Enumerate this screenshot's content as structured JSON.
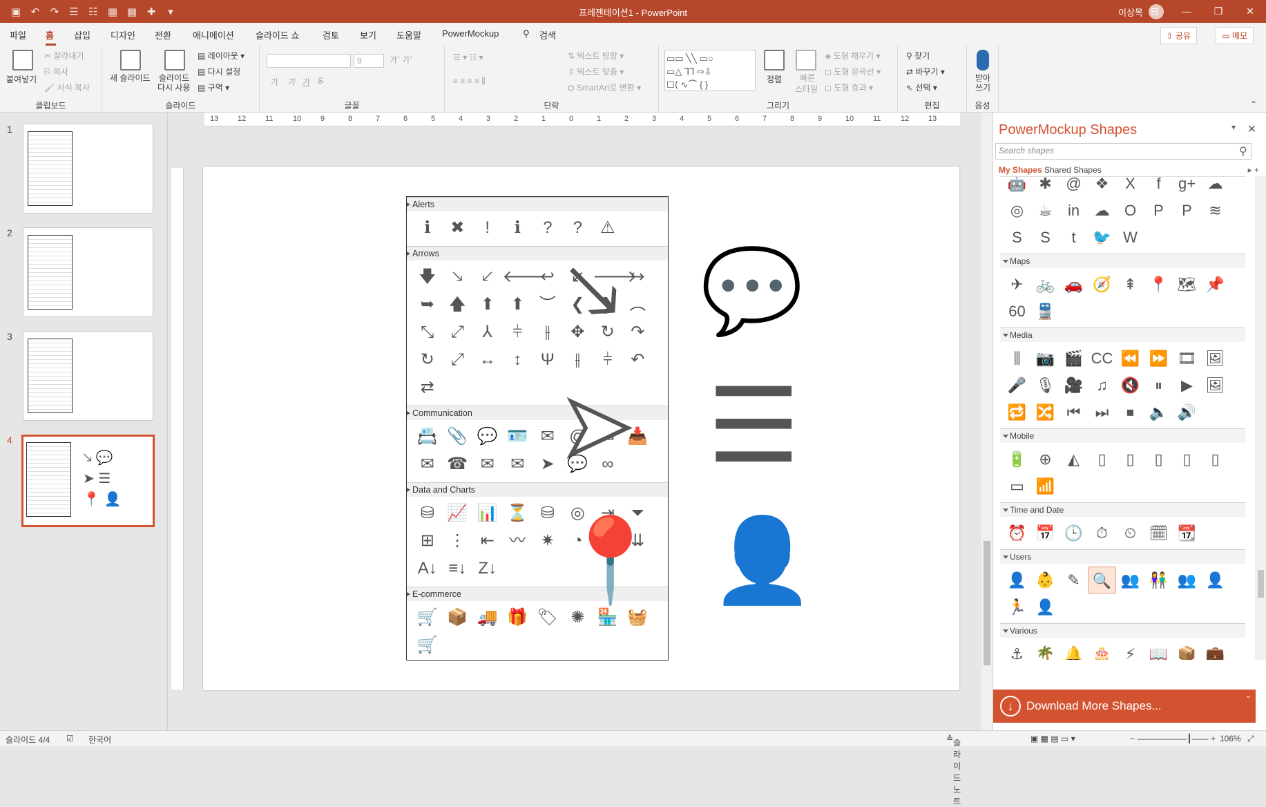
{
  "title_bar": {
    "document_title": "프레젠테이션1 - PowerPoint",
    "user": "이상목",
    "window_controls": [
      "⊟",
      "—",
      "❐",
      "✕"
    ]
  },
  "menu": {
    "tabs": [
      "파일",
      "홈",
      "삽입",
      "디자인",
      "전환",
      "애니메이션",
      "슬라이드 쇼",
      "검토",
      "보기",
      "도움말",
      "PowerMockup"
    ],
    "search": "검색",
    "share": "공유",
    "memo": "메모"
  },
  "ribbon": {
    "clipboard": {
      "paste": "붙여넣기",
      "cut": "잘라내기",
      "copy": "복사",
      "format_painter": "서식 복사",
      "label": "클립보드"
    },
    "slides": {
      "new_slide": "새 슬라이드",
      "reuse_1": "슬라이드",
      "reuse_2": "다시 사용",
      "layout": "레이아웃",
      "reset": "다시 설정",
      "section": "구역",
      "label": "슬라이드"
    },
    "font": {
      "size": "9",
      "label": "글꼴",
      "b": "가",
      "i": "가",
      "u": "가",
      "s": "S"
    },
    "paragraph": {
      "text_direction": "텍스트 방향",
      "align_text": "텍스트 맞춤",
      "smartart": "SmartArt로 변환",
      "label": "단락"
    },
    "drawing": {
      "arrange": "정렬",
      "quick_styles_1": "빠른",
      "quick_styles_2": "스타일",
      "fill": "도형 채우기",
      "outline": "도형 윤곽선",
      "effects": "도형 효과",
      "label": "그리기"
    },
    "editing": {
      "find": "찾기",
      "replace": "바꾸기",
      "select": "선택",
      "label": "편집"
    },
    "voice": {
      "dictate_1": "받아",
      "dictate_2": "쓰기",
      "label": "음성"
    }
  },
  "thumbnails": [
    "1",
    "2",
    "3",
    "4"
  ],
  "ruler": {
    "h_ticks": [
      "13",
      "12",
      "11",
      "10",
      "9",
      "8",
      "7",
      "6",
      "5",
      "4",
      "3",
      "2",
      "1",
      "0",
      "1",
      "2",
      "3",
      "4",
      "5",
      "6",
      "7",
      "8",
      "9",
      "10",
      "11",
      "12",
      "13"
    ]
  },
  "slide_panel": {
    "categories": [
      {
        "name": "Alerts",
        "icons": [
          "ℹ",
          "✖",
          "!",
          "ℹ",
          "?",
          "?",
          "⚠"
        ]
      },
      {
        "name": "Arrows",
        "icons": [
          "🡇",
          "🡖",
          "🡗",
          "🡐",
          "↩",
          "↙",
          "🡒",
          "↪",
          "➥",
          "🡅",
          "⬆",
          "⬆",
          "︶",
          "❮",
          "❯",
          "︵",
          "⤡",
          "⤢",
          "⅄",
          "⫩",
          "⫲",
          "✥",
          "↻",
          "↷",
          "↻",
          "⤢",
          "↔",
          "↕",
          "Ψ",
          "⫲",
          "⫩",
          "↶",
          "⇄"
        ]
      },
      {
        "name": "Communication",
        "icons": [
          "📇",
          "📎",
          "💬",
          "🪪",
          "✉",
          "@",
          "✉",
          "📥",
          "✉",
          "☎",
          "✉",
          "✉",
          "➤",
          "💬",
          "∞"
        ]
      },
      {
        "name": "Data and Charts",
        "icons": [
          "⛁",
          "📈",
          "📊",
          "⏳",
          "⛁",
          "◎",
          "⇥",
          "⏷",
          "⊞",
          "⋮",
          "⇤",
          "〰",
          "✷",
          "◔",
          "⁚",
          "⇊",
          "A↓",
          "≡↓",
          "Z↓"
        ]
      },
      {
        "name": "E-commerce",
        "icons": [
          "🛒",
          "📦",
          "🚚",
          "🎁",
          "🏷",
          "✺",
          "🏪",
          "🧺",
          "🛒"
        ]
      }
    ],
    "big_icons": [
      "🡖",
      "💬",
      "➤",
      "☰",
      "📍",
      "👤"
    ]
  },
  "right_panel": {
    "title": "PowerMockup Shapes",
    "search_placeholder": "Search shapes",
    "tab_my": "My Shapes",
    "tab_shared": "Shared Shapes",
    "top_icons": [
      "🤖",
      "✱",
      "@",
      "❖",
      "X",
      "f",
      "g+",
      "☁",
      "◎",
      "☕",
      "in",
      "☁",
      "O",
      "P",
      "P",
      "≋",
      "S",
      "S",
      "t",
      "🐦",
      "W"
    ],
    "categories": [
      {
        "name": "Maps",
        "icons": [
          "✈",
          "🚲",
          "🚗",
          "🧭",
          "⇞",
          "📍",
          "🗺",
          "📌",
          "60",
          "🚆"
        ]
      },
      {
        "name": "Media",
        "icons": [
          "⫼",
          "📷",
          "🎬",
          "CC",
          "⏪",
          "⏩",
          "🎞",
          "🖼",
          "🎤",
          "🎙",
          "🎥",
          "♫",
          "🔇",
          "⏸",
          "▶",
          "🖼",
          "🔁",
          "🔀",
          "⏮",
          "⏭",
          "⏹",
          "🔈",
          "🔊"
        ]
      },
      {
        "name": "Mobile",
        "icons": [
          "🔋",
          "⊕",
          "◭",
          "▯",
          "▯",
          "▯",
          "▯",
          "▯",
          "▭",
          "📶"
        ]
      },
      {
        "name": "Time and Date",
        "icons": [
          "⏰",
          "📅",
          "🕒",
          "⏱",
          "⏲",
          "🗓",
          "📆"
        ]
      },
      {
        "name": "Users",
        "icons": [
          "👤",
          "👶",
          "✎",
          "🔍",
          "👥",
          "👫",
          "👥",
          "👤",
          "🏃",
          "👤"
        ]
      },
      {
        "name": "Various",
        "icons": [
          "⚓",
          "🌴",
          "🔔",
          "🎂",
          "⚡",
          "📖",
          "📦",
          "💼",
          "🐞",
          "♡",
          "🏅",
          "☰",
          "⌨",
          "☁",
          "</>",
          "☕"
        ]
      }
    ],
    "download": "Download More Shapes..."
  },
  "status": {
    "slide": "슬라이드 4/4",
    "language": "한국어",
    "notes": "슬라이드 노트",
    "zoom": "106%"
  }
}
